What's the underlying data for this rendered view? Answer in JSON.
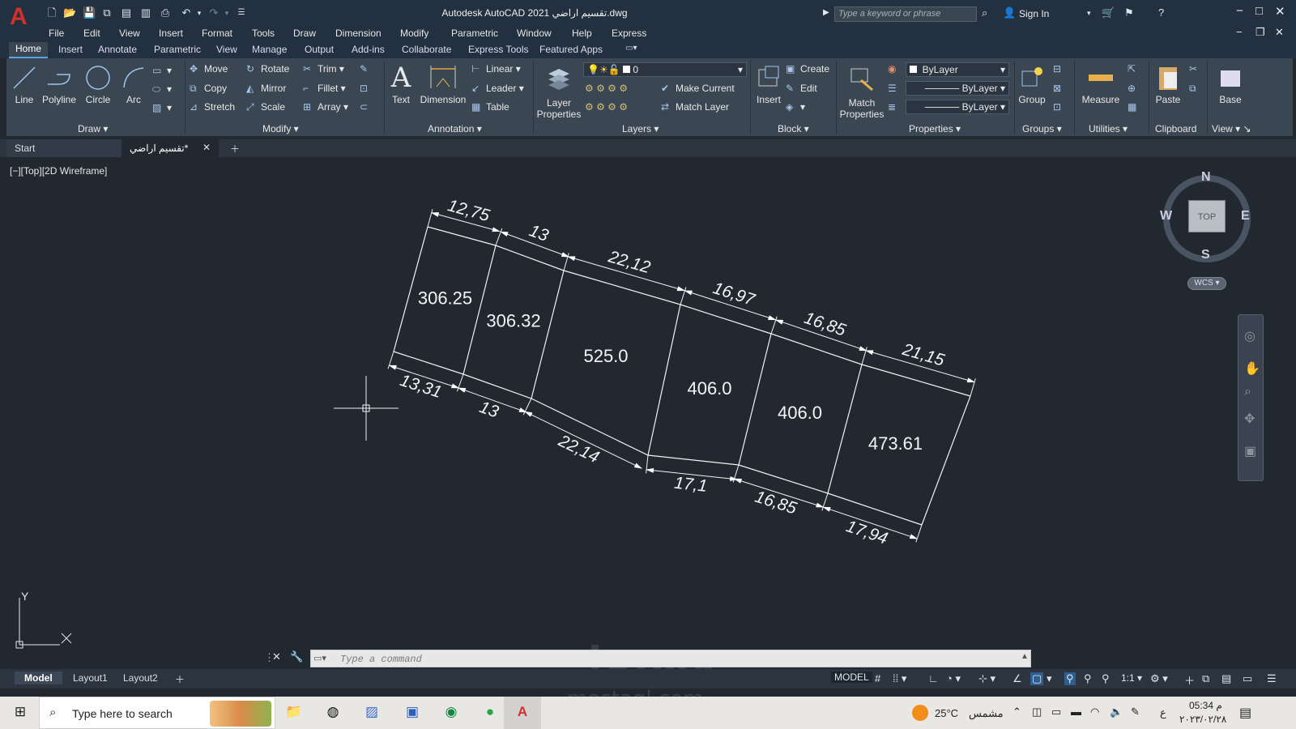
{
  "app": {
    "title": "Autodesk AutoCAD 2021  تقسيم اراضي.dwg",
    "search_placeholder": "Type a keyword or phrase",
    "signin": "Sign In",
    "logo_letter": "A"
  },
  "menu": [
    "File",
    "Edit",
    "View",
    "Insert",
    "Format",
    "Tools",
    "Draw",
    "Dimension",
    "Modify",
    "Parametric",
    "Window",
    "Help",
    "Express"
  ],
  "ribbon_tabs": [
    "Home",
    "Insert",
    "Annotate",
    "Parametric",
    "View",
    "Manage",
    "Output",
    "Add-ins",
    "Collaborate",
    "Express Tools",
    "Featured Apps"
  ],
  "ribbon": {
    "draw": {
      "title": "Draw",
      "line": "Line",
      "polyline": "Polyline",
      "circle": "Circle",
      "arc": "Arc"
    },
    "modify": {
      "title": "Modify",
      "move": "Move",
      "rotate": "Rotate",
      "trim": "Trim",
      "copy": "Copy",
      "mirror": "Mirror",
      "fillet": "Fillet",
      "stretch": "Stretch",
      "scale": "Scale",
      "array": "Array"
    },
    "annotation": {
      "title": "Annotation",
      "text": "Text",
      "dimension": "Dimension",
      "linear": "Linear",
      "leader": "Leader",
      "table": "Table"
    },
    "layers": {
      "title": "Layers",
      "layer_properties_1": "Layer",
      "layer_properties_2": "Properties",
      "current_layer": "0",
      "make_current": "Make Current",
      "match_layer": "Match Layer"
    },
    "block": {
      "title": "Block",
      "insert": "Insert",
      "create": "Create",
      "edit": "Edit"
    },
    "properties": {
      "title": "Properties",
      "match_1": "Match",
      "match_2": "Properties",
      "color": "ByLayer",
      "linetype": "ByLayer",
      "lineweight": "ByLayer"
    },
    "groups": {
      "title": "Groups",
      "group": "Group"
    },
    "utilities": {
      "title": "Utilities",
      "measure": "Measure"
    },
    "clipboard": {
      "title": "Clipboard",
      "paste": "Paste"
    },
    "view": {
      "title": "View",
      "base": "Base"
    }
  },
  "doc_tabs": {
    "start": "Start",
    "drawing": "تقسيم اراضي*"
  },
  "viewport": {
    "label": "[−][Top][2D Wireframe]"
  },
  "viewcube": {
    "n": "N",
    "s": "S",
    "e": "E",
    "w": "W",
    "top": "TOP",
    "wcs": "WCS"
  },
  "ucs": {
    "y": "Y",
    "x": "X"
  },
  "drawing": {
    "areas": [
      "306.25",
      "306.32",
      "525.0",
      "406.0",
      "406.0",
      "473.61"
    ],
    "top_dims": [
      "12,75",
      "13",
      "22,12",
      "16,97",
      "16,85",
      "21,15"
    ],
    "bottom_dims": [
      "13,31",
      "13",
      "22,14",
      "17,1",
      "16,85",
      "17,94"
    ]
  },
  "command": {
    "placeholder": "Type  a  command"
  },
  "layout_tabs": [
    "Model",
    "Layout1",
    "Layout2"
  ],
  "status": {
    "model": "MODEL",
    "scale": "1:1"
  },
  "taskbar": {
    "search": "Type here to search",
    "temp": "25°C",
    "weather": "مشمس",
    "time": "05:34 م",
    "date": "٢٠٢٣/٠٢/٢٨",
    "lang": "ع"
  },
  "watermark": {
    "line1": "مستقل",
    "line2": "mostaql.com"
  },
  "colors": {
    "accent": "#5aa1e6",
    "logo": "#d0312d",
    "ribbon": "#3b4653",
    "canvas": "#212830"
  }
}
